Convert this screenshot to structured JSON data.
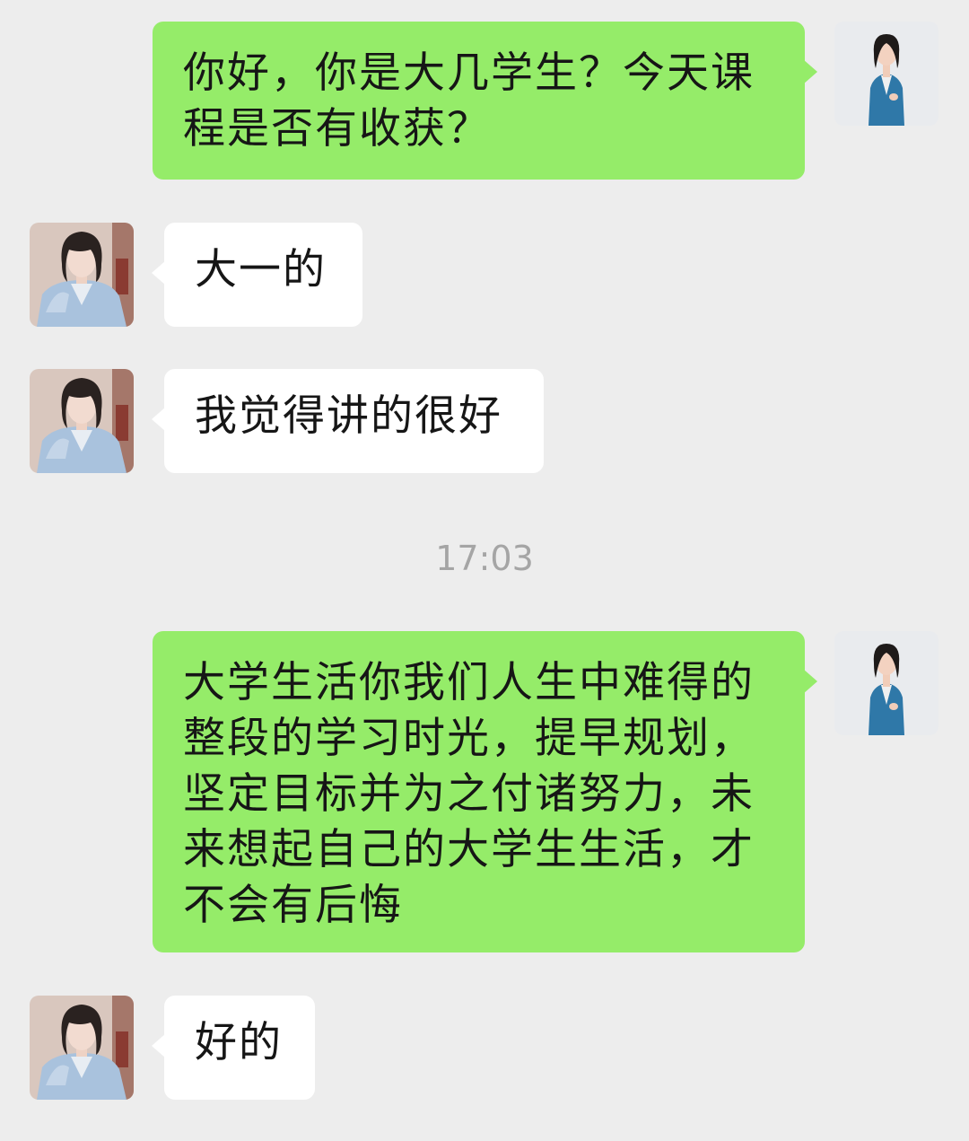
{
  "chat": {
    "messages": [
      {
        "sender": "self",
        "text": "你好，你是大几学生？今天课程是否有收获？"
      },
      {
        "sender": "other",
        "text": "大一的"
      },
      {
        "sender": "other",
        "text": "我觉得讲的很好"
      },
      {
        "sender": "self",
        "text": "大学生活你我们人生中难得的整段的学习时光，提早规划，坚定目标并为之付诸努力，未来想起自己的大学生生活，才不会有后悔"
      },
      {
        "sender": "other",
        "text": "好的"
      }
    ],
    "timestamp": "17:03"
  },
  "colors": {
    "background": "#ededed",
    "self_bubble": "#95ec69",
    "other_bubble": "#ffffff",
    "timestamp_text": "#a5a5a5"
  },
  "icons": {
    "self_avatar": "woman-in-blue-blazer-avatar",
    "other_avatar": "girl-in-denim-jacket-avatar"
  }
}
